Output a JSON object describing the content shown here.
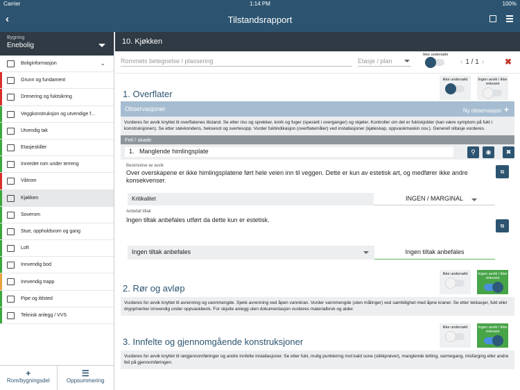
{
  "status": {
    "carrier": "Carrier",
    "time": "1:14 PM",
    "battery": "100%"
  },
  "header": {
    "title": "Tilstandsrapport"
  },
  "sidebar": {
    "building_label": "Bygning",
    "building_value": "Enebolig",
    "items": [
      {
        "label": "Boliginformasjon",
        "color": "#ffffff",
        "icon": "house-icon"
      },
      {
        "label": "Grunn og fundament",
        "color": "#d9302c",
        "icon": "foundation-icon"
      },
      {
        "label": "Drenering og fuktsikring",
        "color": "#d9302c",
        "icon": "drainage-icon"
      },
      {
        "label": "Veggkonstruksjon og utvendige f...",
        "color": "#3ca73c",
        "icon": "wall-icon"
      },
      {
        "label": "Utvendig tak",
        "color": "#3ca73c",
        "icon": "roof-icon"
      },
      {
        "label": "Etasjeskiller",
        "color": "#3ca73c",
        "icon": "floor-icon"
      },
      {
        "label": "Innredet rom under terreng",
        "color": "#3ca73c",
        "icon": "basement-icon"
      },
      {
        "label": "Våtrom",
        "color": "#d9302c",
        "icon": "bathroom-icon"
      },
      {
        "label": "Kjøkken",
        "color": "#3ca73c",
        "icon": "kitchen-icon"
      },
      {
        "label": "Soverom",
        "color": "#3ca73c",
        "icon": "bedroom-icon"
      },
      {
        "label": "Stue, oppholdsrom og gang",
        "color": "#3ca73c",
        "icon": "livingroom-icon"
      },
      {
        "label": "Loft",
        "color": "#3ca73c",
        "icon": "attic-icon"
      },
      {
        "label": "Innvendig bod",
        "color": "#3ca73c",
        "icon": "storage-icon"
      },
      {
        "label": "Innvendig trapp",
        "color": "#e8a33c",
        "icon": "stairs-icon"
      },
      {
        "label": "Pipe og ildsted",
        "color": "#3ca73c",
        "icon": "fireplace-icon"
      },
      {
        "label": "Teknisk anlegg / VVS",
        "color": "#3ca73c",
        "icon": "plumbing-icon"
      }
    ],
    "footer": {
      "add_label": "Rom/bygningsdel",
      "summary_label": "Oppsummering"
    }
  },
  "main": {
    "room_title": "10. Kjøkken",
    "room_placeholder": "Rommets betegnelse / plassering",
    "etasje_placeholder": "Etasje / plan",
    "ikke_undersokt": "Ikke undersøkt",
    "pager": "1 / 1",
    "sections": [
      {
        "title": "1. Overflater",
        "toggle1": "Ikke undersøkt",
        "toggle2": "Ingen avvik / ikke relevant",
        "obs_label": "Observasjoner",
        "ny_obs": "Ny observasjon",
        "description": "Vurderes for avvik knyttet til overflatenes tilstand. Se etter riss og sprekker, knirk og fuger (spesielt i overganger) og skjøter. Kontroller om det er fuktskjolder (kan være symptom på fukt i konstruksjonen). Se etter støvkondens, heksesot og svertesopp. Vurder fuktindikasjon (overflatemåler) ved installasjoner (kjøleskap, oppvaskmaskin osv.). Generell slitasje vurderes.",
        "feil_label": "Feil / skade",
        "feil_number": "1.",
        "feil_value": "Manglende himlingsplate",
        "beskrivelse_label": "Beskrivelse av avvik",
        "beskrivelse": "Over overskapene er ikke himlingsplatene ført hele veien inn til veggen. Dette er kun av estetisk art, og medfører ikke andre konsekvenser.",
        "kritikalitet_label": "Kritikalitet",
        "kritikalitet_value": "INGEN / MARGINAL",
        "tiltak_label": "Anbefalt tiltak",
        "tiltak": "Ingen tiltak anbefales utført da dette kun er estetisk.",
        "tiltak_select": "Ingen tiltak anbefales",
        "tiltak_result": "Ingen tiltak anbefales"
      },
      {
        "title": "2. Rør og avløp",
        "toggle1": "Ikke undersøkt",
        "toggle2": "Ingen avvik / ikke relevant",
        "description": "Vurderes for avvik knyttet til avrenning og vannmengde. Sjekk avrenning ved åpen vannkran. Vurder vannmengde (uten målinger) ved samtidighet med åpne kraner. Se etter lekkasjer, fukt eller dryppmerker innvendig under oppvaskbenk. For skjulte anlegg uten dokumentasjon vurderes materialbruk og alder."
      },
      {
        "title": "3. Innfelte og gjennomgående konstruksjoner",
        "toggle1": "Ikke undersøkt",
        "toggle2": "Ingen avvik / ikke relevant",
        "description": "Vurderes for avvik knyttet til rørgjennomføringer og andre innfelte installasjoner. Se etter fukt, mulig punktering mot kald sone (stikkprøver), manglende tetting, varmegang, misfarging eller andre feil på gjennomføringen."
      }
    ]
  }
}
